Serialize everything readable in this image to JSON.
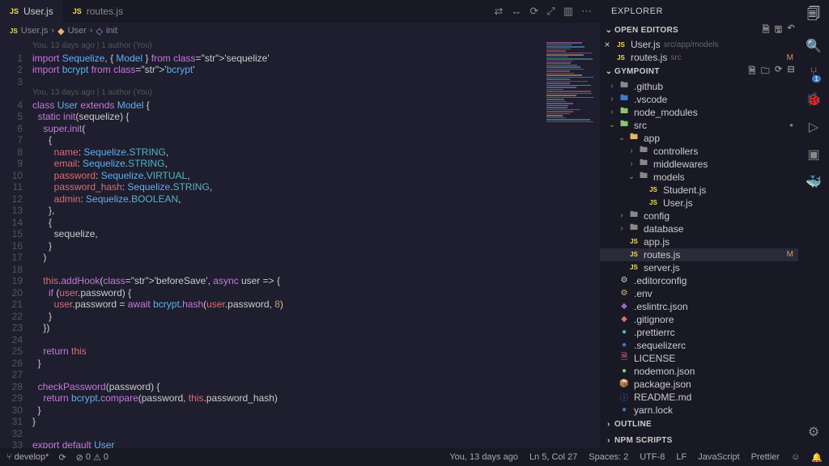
{
  "tabs": [
    {
      "icon": "JS",
      "label": "User.js",
      "active": true
    },
    {
      "icon": "JS",
      "label": "routes.js",
      "active": false
    }
  ],
  "breadcrumb": {
    "file": "User.js",
    "class": "User",
    "method": "init"
  },
  "codelens1": "You, 13 days ago | 1 author (You)",
  "codelens2": "You, 13 days ago | 1 author (You)",
  "lines": [
    "import Sequelize, { Model } from 'sequelize'",
    "import bcrypt from 'bcrypt'",
    "",
    "class User extends Model {",
    "  static init(sequelize) {",
    "    super.init(",
    "      {",
    "        name: Sequelize.STRING,",
    "        email: Sequelize.STRING,",
    "        password: Sequelize.VIRTUAL,",
    "        password_hash: Sequelize.STRING,",
    "        admin: Sequelize.BOOLEAN,",
    "      },",
    "      {",
    "        sequelize,",
    "      }",
    "    )",
    "",
    "    this.addHook('beforeSave', async user => {",
    "      if (user.password) {",
    "        user.password = await bcrypt.hash(user.password, 8)",
    "      }",
    "    })",
    "",
    "    return this",
    "  }",
    "",
    "  checkPassword(password) {",
    "    return bcrypt.compare(password, this.password_hash)",
    "  }",
    "}",
    "",
    "export default User",
    ""
  ],
  "explorer": {
    "title": "EXPLORER"
  },
  "sections": {
    "openEditors": "OPEN EDITORS",
    "project": "GYMPOINT",
    "outline": "OUTLINE",
    "npm": "NPM SCRIPTS"
  },
  "openEditors": [
    {
      "icon": "JS",
      "label": "User.js",
      "hint": "src/app/models",
      "close": true
    },
    {
      "icon": "JS",
      "label": "routes.js",
      "hint": "src",
      "mod": "M"
    }
  ],
  "tree": [
    {
      "d": 0,
      "chev": "›",
      "icon": "folder",
      "label": ".github",
      "color": "#888"
    },
    {
      "d": 0,
      "chev": "›",
      "icon": "folder",
      "label": ".vscode",
      "color": "#3d7ace"
    },
    {
      "d": 0,
      "chev": "›",
      "icon": "folder",
      "label": "node_modules",
      "color": "#89c66d"
    },
    {
      "d": 0,
      "chev": "⌄",
      "icon": "folder",
      "label": "src",
      "color": "#89c66d",
      "dot": true
    },
    {
      "d": 1,
      "chev": "⌄",
      "icon": "folder",
      "label": "app",
      "color": "#e5b568"
    },
    {
      "d": 2,
      "chev": "›",
      "icon": "folder",
      "label": "controllers",
      "color": "#888"
    },
    {
      "d": 2,
      "chev": "›",
      "icon": "folder",
      "label": "middlewares",
      "color": "#888"
    },
    {
      "d": 2,
      "chev": "⌄",
      "icon": "folder",
      "label": "models",
      "color": "#888"
    },
    {
      "d": 3,
      "chev": "",
      "icon": "js",
      "label": "Student.js"
    },
    {
      "d": 3,
      "chev": "",
      "icon": "js",
      "label": "User.js"
    },
    {
      "d": 1,
      "chev": "›",
      "icon": "folder",
      "label": "config",
      "color": "#888"
    },
    {
      "d": 1,
      "chev": "›",
      "icon": "folder",
      "label": "database",
      "color": "#888"
    },
    {
      "d": 1,
      "chev": "",
      "icon": "js",
      "label": "app.js"
    },
    {
      "d": 1,
      "chev": "",
      "icon": "js",
      "label": "routes.js",
      "active": true,
      "mod": "M"
    },
    {
      "d": 1,
      "chev": "",
      "icon": "js",
      "label": "server.js"
    },
    {
      "d": 0,
      "chev": "",
      "icon": "gear",
      "label": ".editorconfig",
      "color": "#ccc"
    },
    {
      "d": 0,
      "chev": "",
      "icon": "gear",
      "label": ".env",
      "color": "#e5b568"
    },
    {
      "d": 0,
      "chev": "",
      "icon": "eslint",
      "label": ".eslintrc.json",
      "color": "#8e6cc8"
    },
    {
      "d": 0,
      "chev": "",
      "icon": "git",
      "label": ".gitignore",
      "color": "#e06c75"
    },
    {
      "d": 0,
      "chev": "",
      "icon": "prettier",
      "label": ".prettierrc",
      "color": "#56b6c2"
    },
    {
      "d": 0,
      "chev": "",
      "icon": "seq",
      "label": ".sequelizerc",
      "color": "#3d7ace"
    },
    {
      "d": 0,
      "chev": "",
      "icon": "license",
      "label": "LICENSE",
      "color": "#e06c75"
    },
    {
      "d": 0,
      "chev": "",
      "icon": "nodemon",
      "label": "nodemon.json",
      "color": "#89c66d"
    },
    {
      "d": 0,
      "chev": "",
      "icon": "npm",
      "label": "package.json",
      "color": "#e06c75"
    },
    {
      "d": 0,
      "chev": "",
      "icon": "md",
      "label": "README.md",
      "color": "#3d7ace"
    },
    {
      "d": 0,
      "chev": "",
      "icon": "yarn",
      "label": "yarn.lock",
      "color": "#3d7ace"
    }
  ],
  "status": {
    "branch": "develop*",
    "sync": "⟳",
    "err0": "0",
    "err1": "0",
    "blame": "You, 13 days ago",
    "ln": "Ln 5, Col 27",
    "spaces": "Spaces: 2",
    "enc": "UTF-8",
    "eol": "LF",
    "lang": "JavaScript",
    "prettier": "Prettier",
    "bell": "🔔"
  }
}
